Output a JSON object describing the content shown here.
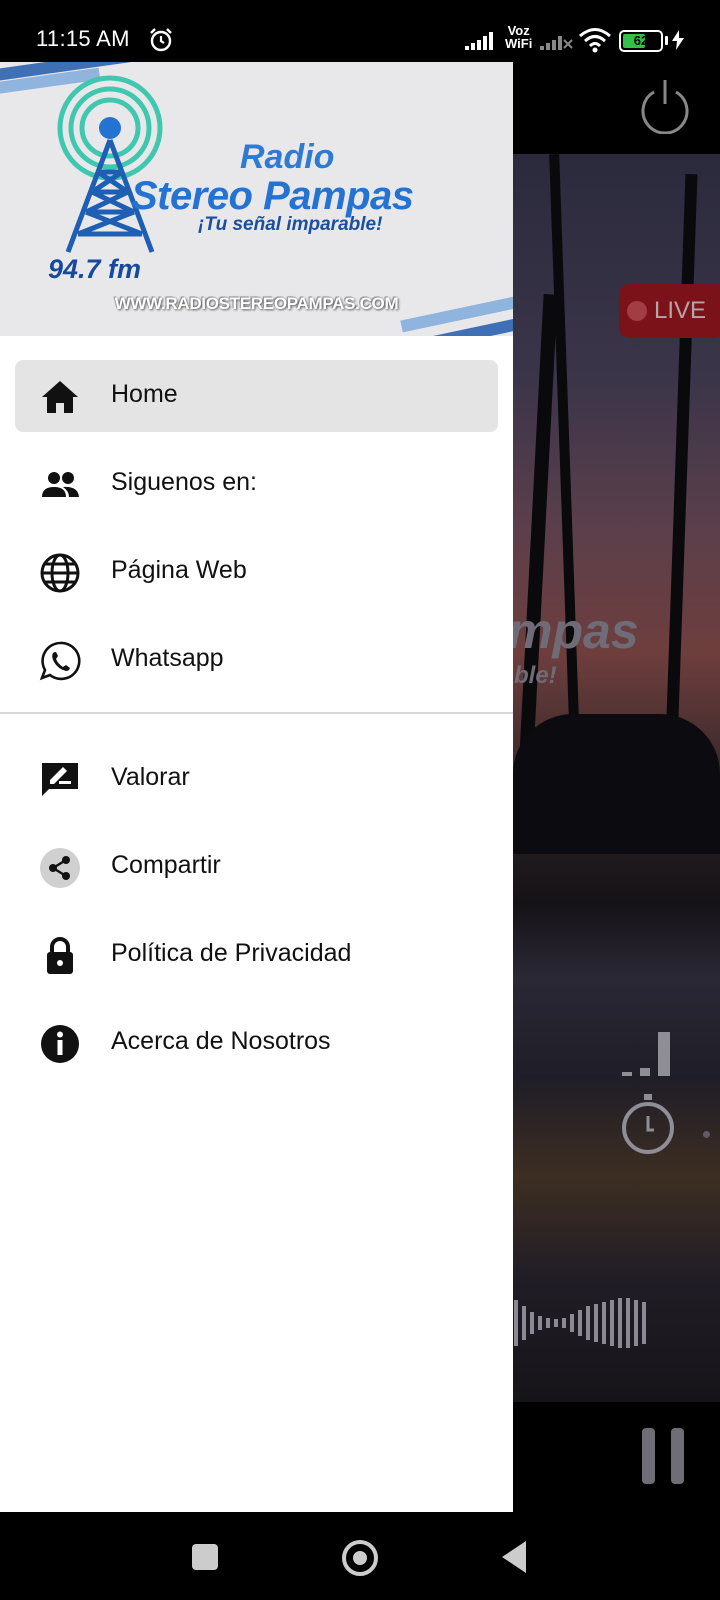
{
  "status_bar": {
    "time": "11:15 AM",
    "voz_wifi_line1": "Voz",
    "voz_wifi_line2": "WiFi",
    "battery_percent": "62",
    "battery_level": 0.62
  },
  "background_app": {
    "live_label": "LIVE",
    "bg_logo_text": "mpas",
    "bg_logo_sub": "ble!"
  },
  "drawer": {
    "header": {
      "brand_radio": "Radio",
      "brand_name": "Stereo Pampas",
      "slogan": "¡Tu señal imparable!",
      "frequency": "94.7 fm",
      "url": "WWW.RADIOSTEREOPAMPAS.COM"
    },
    "items": [
      {
        "label": "Home",
        "icon": "home-icon",
        "active": true
      },
      {
        "label": "Siguenos en:",
        "icon": "people-icon"
      },
      {
        "label": "Página Web",
        "icon": "globe-icon"
      },
      {
        "label": "Whatsapp",
        "icon": "whatsapp-icon"
      },
      {
        "label": "Valorar",
        "icon": "rate-review-icon"
      },
      {
        "label": "Compartir",
        "icon": "share-icon"
      },
      {
        "label": "Política de Privacidad",
        "icon": "lock-icon"
      },
      {
        "label": "Acerca de Nosotros",
        "icon": "info-icon"
      }
    ]
  },
  "colors": {
    "brand_blue": "#2472d1",
    "brand_teal": "#3fc7b0",
    "drawer_header_bg": "#e8e8ea",
    "active_item_bg": "#e4e4e4",
    "live_badge": "#7c1219"
  }
}
